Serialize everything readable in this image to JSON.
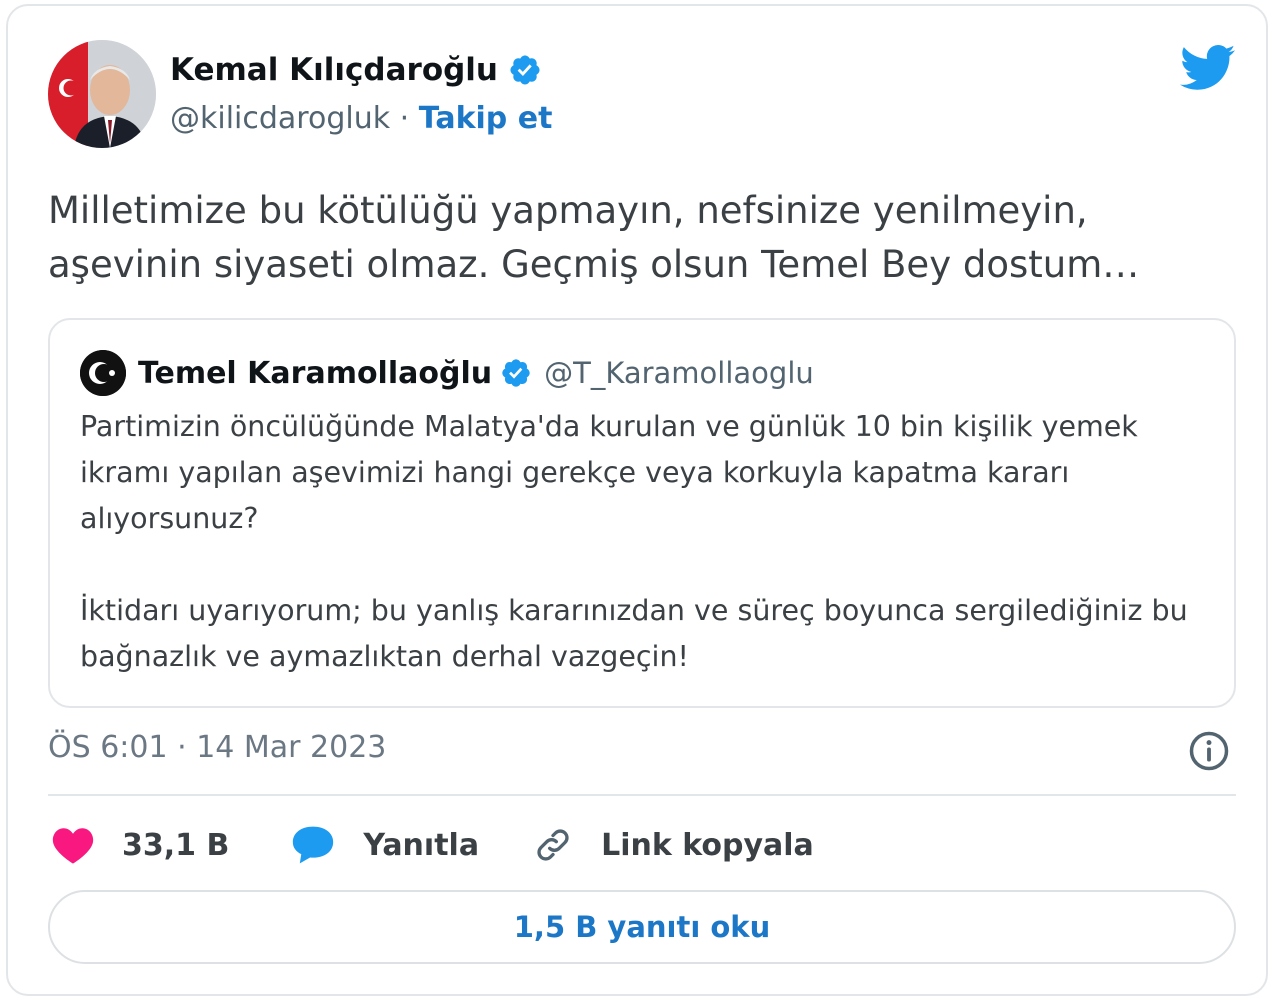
{
  "author": {
    "name": "Kemal Kılıçdaroğlu",
    "handle": "@kilicdarogluk",
    "separator": "·",
    "follow_label": "Takip et"
  },
  "tweet": {
    "text_line1": "Milletimize bu kötülüğü yapmayın, nefsinize yenilmeyin,",
    "text_line2": "aşevinin siyaseti olmaz. Geçmiş olsun Temel Bey dostum…"
  },
  "quoted_tweet": {
    "name": "Temel Karamollaoğlu",
    "handle": "@T_Karamollaoglu",
    "paragraph1": "Partimizin öncülüğünde Malatya'da kurulan ve günlük 10 bin kişilik yemek ikramı yapılan aşevimizi hangi gerekçe veya korkuyla kapatma kararı alıyorsunuz?",
    "paragraph2": "İktidarı uyarıyorum; bu yanlış kararınızdan ve süreç boyunca sergilediğiniz bu bağnazlık ve aymazlıktan derhal vazgeçin!"
  },
  "meta": {
    "time": "ÖS 6:01",
    "separator": "·",
    "date": "14 Mar 2023"
  },
  "actions": {
    "likes": "33,1 B",
    "reply_label": "Yanıtla",
    "copy_link_label": "Link kopyala"
  },
  "read_replies_label": "1,5 B yanıtı oku",
  "icons": {
    "verified": "verified-badge-icon",
    "brand": "twitter-bird-icon",
    "like": "heart-icon",
    "reply": "speech-bubble-icon",
    "link": "link-icon",
    "info": "info-icon"
  },
  "colors": {
    "brand_blue": "#1d9bf0",
    "link_blue": "#1d77c7",
    "heart_pink": "#f91880",
    "text_gray": "#536471"
  }
}
